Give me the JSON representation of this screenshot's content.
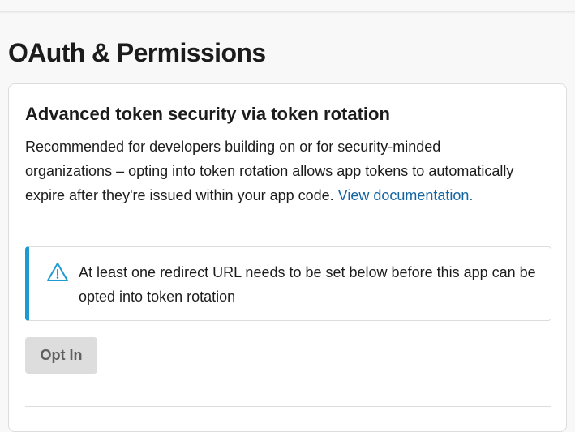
{
  "page": {
    "title": "OAuth & Permissions"
  },
  "token_rotation": {
    "title": "Advanced token security via token rotation",
    "description": "Recommended for developers building on or for security-minded organizations – opting into token rotation allows app tokens to automatically expire after they're issued within your app code. ",
    "link_label": "View documentation.",
    "alert": {
      "icon": "warning-triangle-icon",
      "text": "At least one redirect URL needs to be set below before this app can be opted into token rotation"
    },
    "opt_in_label": "Opt In"
  },
  "colors": {
    "link": "#1264a3",
    "alert_accent": "#1d9bd1",
    "button_bg": "#dddddd",
    "button_text": "#616061"
  }
}
